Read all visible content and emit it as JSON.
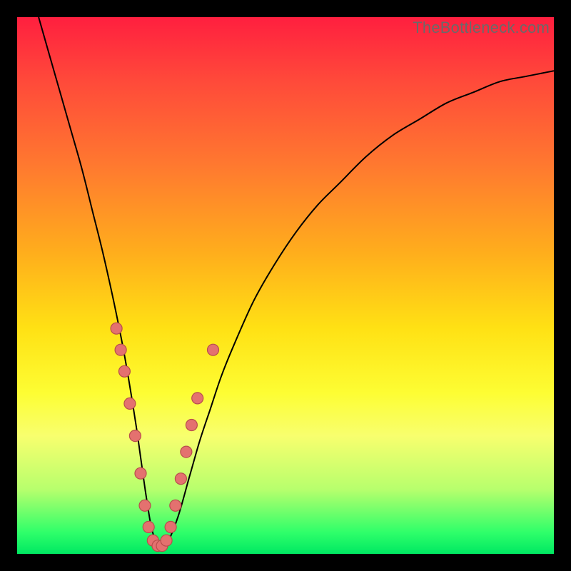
{
  "watermark": "TheBottleneck.com",
  "colors": {
    "frame": "#000000",
    "gradient_top": "#ff1f3f",
    "gradient_bottom": "#00e862",
    "curve": "#000000",
    "dot_fill": "#e4716f",
    "dot_stroke": "#b84d4c"
  },
  "chart_data": {
    "type": "line",
    "title": "",
    "xlabel": "",
    "ylabel": "",
    "xlim": [
      0,
      100
    ],
    "ylim": [
      0,
      100
    ],
    "grid": false,
    "legend": false,
    "series": [
      {
        "name": "curve",
        "x": [
          4,
          6,
          8,
          10,
          12,
          14,
          16,
          18,
          20,
          22,
          23,
          24,
          25,
          26,
          27,
          28,
          30,
          32,
          34,
          36,
          38,
          40,
          44,
          48,
          52,
          56,
          60,
          65,
          70,
          75,
          80,
          85,
          90,
          95,
          100
        ],
        "y": [
          100,
          93,
          86,
          79,
          72,
          64,
          56,
          47,
          37,
          25,
          18,
          11,
          5,
          2,
          1,
          2,
          7,
          14,
          21,
          27,
          33,
          38,
          47,
          54,
          60,
          65,
          69,
          74,
          78,
          81,
          84,
          86,
          88,
          89,
          90
        ]
      }
    ],
    "points": [
      {
        "x": 18.5,
        "y": 42
      },
      {
        "x": 19.3,
        "y": 38
      },
      {
        "x": 20.0,
        "y": 34
      },
      {
        "x": 21.0,
        "y": 28
      },
      {
        "x": 22.0,
        "y": 22
      },
      {
        "x": 23.0,
        "y": 15
      },
      {
        "x": 23.8,
        "y": 9
      },
      {
        "x": 24.5,
        "y": 5
      },
      {
        "x": 25.3,
        "y": 2.5
      },
      {
        "x": 26.2,
        "y": 1.5
      },
      {
        "x": 27.0,
        "y": 1.5
      },
      {
        "x": 27.8,
        "y": 2.5
      },
      {
        "x": 28.6,
        "y": 5
      },
      {
        "x": 29.5,
        "y": 9
      },
      {
        "x": 30.5,
        "y": 14
      },
      {
        "x": 31.5,
        "y": 19
      },
      {
        "x": 32.5,
        "y": 24
      },
      {
        "x": 33.6,
        "y": 29
      },
      {
        "x": 36.5,
        "y": 38
      }
    ],
    "point_radius": 8
  }
}
